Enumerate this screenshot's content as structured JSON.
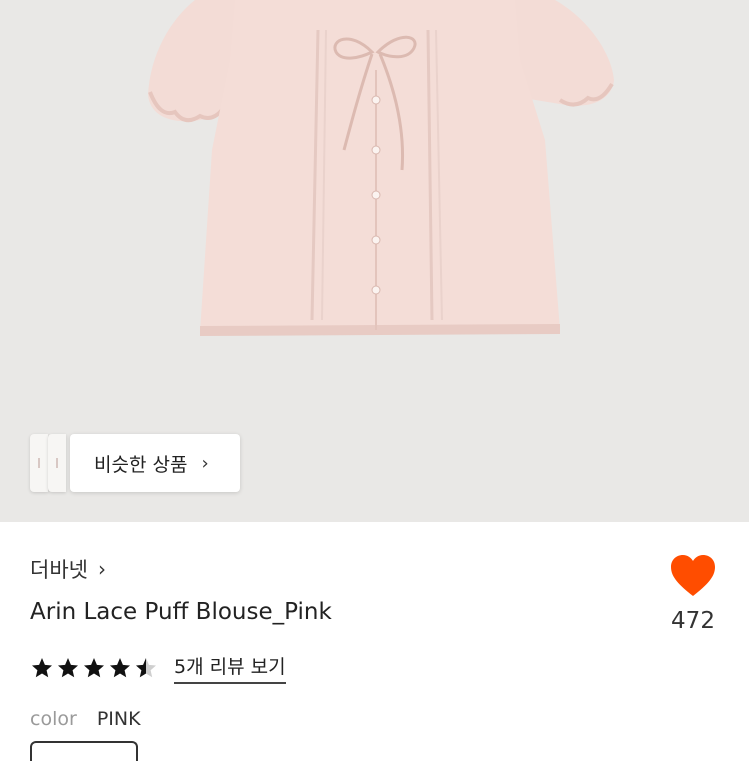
{
  "hero": {
    "similar_label": "비슷한 상품",
    "chevron": "›"
  },
  "product": {
    "brand": "더바넷",
    "brand_chevron": "›",
    "title": "Arin Lace Puff Blouse_Pink",
    "rating": 4.5,
    "review_link": "5개 리뷰 보기",
    "color_label": "color",
    "color_value": "PINK",
    "like_count": "472"
  },
  "colors": {
    "heart": "#ff4d00",
    "blouse": "#f3dcd6",
    "background": "#e9e8e6"
  },
  "icons": {
    "heart": "heart-icon",
    "star": "star-icon",
    "chevron": "chevron-right-icon"
  }
}
